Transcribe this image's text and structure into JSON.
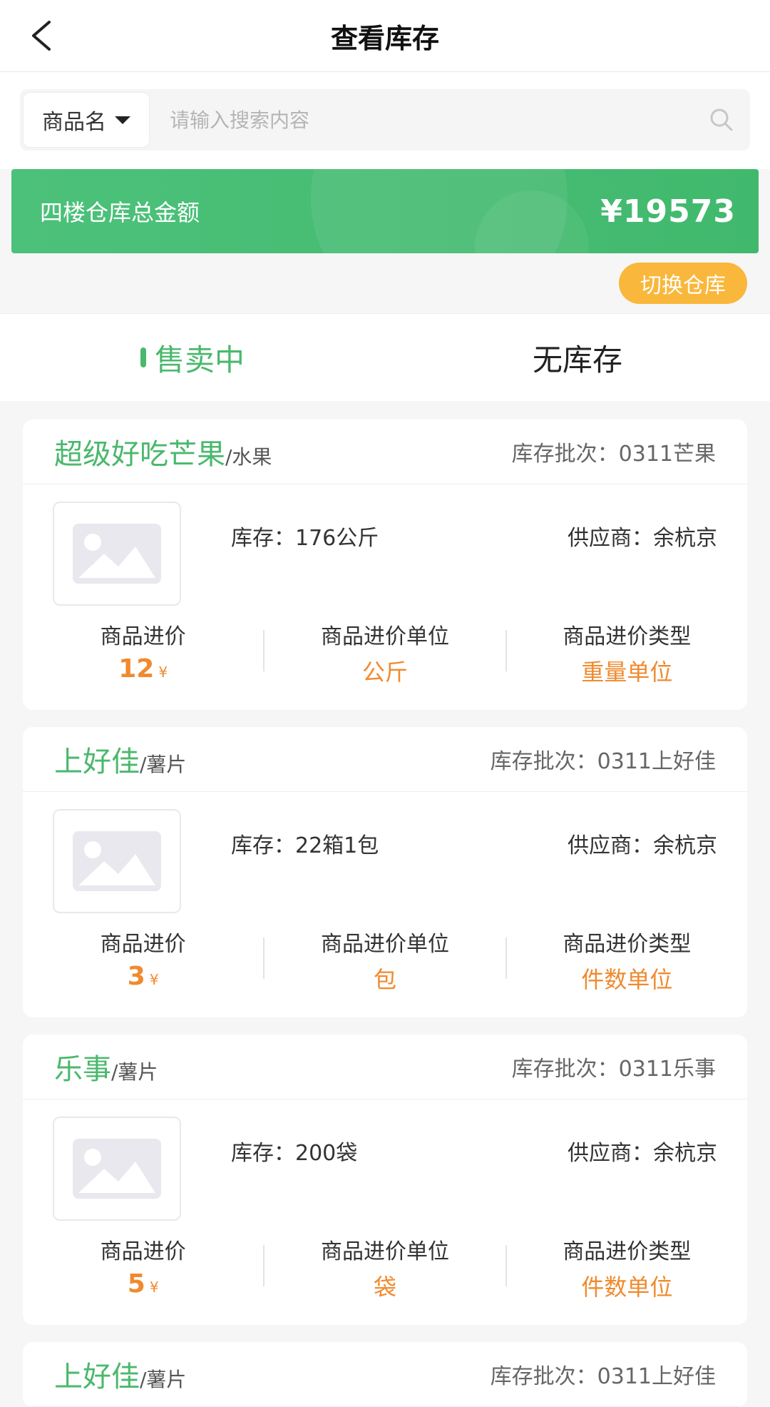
{
  "header": {
    "title": "查看库存"
  },
  "search": {
    "type_label": "商品名",
    "placeholder": "请输入搜索内容"
  },
  "banner": {
    "label": "四楼仓库总金额",
    "amount": "¥19573"
  },
  "switch_label": "切换仓库",
  "tabs": [
    {
      "label": "售卖中",
      "active": true
    },
    {
      "label": "无库存",
      "active": false
    }
  ],
  "labels": {
    "batch_prefix": "库存批次：",
    "stock_prefix": "库存：",
    "supplier_prefix": "供应商：",
    "price": "商品进价",
    "price_unit": "商品进价单位",
    "price_type": "商品进价类型",
    "currency": "¥"
  },
  "colors": {
    "accent_green": "#4bb86d",
    "accent_orange": "#f08a2e",
    "switch_yellow": "#f9b73b"
  },
  "items": [
    {
      "name": "超级好吃芒果",
      "category": "/水果",
      "batch": "0311芒果",
      "stock": "176公斤",
      "supplier": "余杭京",
      "price": "12",
      "price_unit": "公斤",
      "price_type": "重量单位"
    },
    {
      "name": "上好佳",
      "category": "/薯片",
      "batch": "0311上好佳",
      "stock": "22箱1包",
      "supplier": "余杭京",
      "price": "3",
      "price_unit": "包",
      "price_type": "件数单位"
    },
    {
      "name": "乐事",
      "category": "/薯片",
      "batch": "0311乐事",
      "stock": "200袋",
      "supplier": "余杭京",
      "price": "5",
      "price_unit": "袋",
      "price_type": "件数单位"
    },
    {
      "name": "上好佳",
      "category": "/薯片",
      "batch": "0311上好佳",
      "stock": "",
      "supplier": "",
      "price": "",
      "price_unit": "",
      "price_type": ""
    }
  ]
}
